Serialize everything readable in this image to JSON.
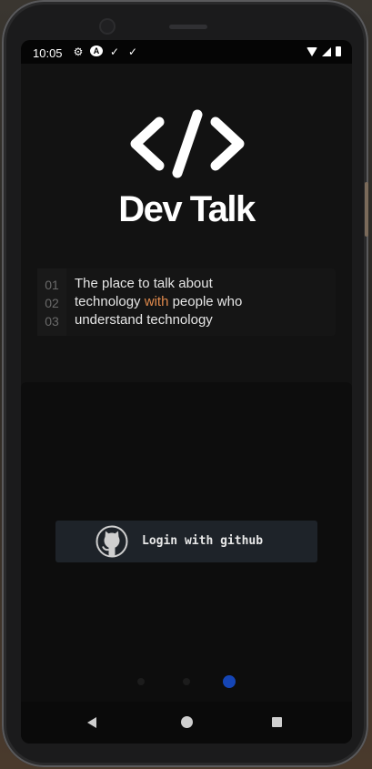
{
  "status_bar": {
    "time": "10:05",
    "left_icons": [
      "gear-icon",
      "a-badge-icon",
      "checkmark-icon",
      "checkmark-icon"
    ],
    "right_icons": [
      "wifi-icon",
      "signal-icon",
      "battery-icon"
    ]
  },
  "app": {
    "logo_icon": "code-brackets-icon",
    "title": "Dev Talk",
    "tagline": {
      "line_numbers": [
        "01",
        "02",
        "03"
      ],
      "line1": "The place to talk about",
      "line2_pre": "technology ",
      "line2_accent": "with",
      "line2_post": " people who",
      "line3": "understand technology"
    },
    "login_button": {
      "icon": "github-icon",
      "label": "Login with github"
    },
    "pager": {
      "count": 3,
      "active_index": 2
    }
  },
  "nav_bar": {
    "buttons": [
      "back",
      "home",
      "recents"
    ]
  },
  "colors": {
    "background": "#121212",
    "accent_text": "#e08a4c",
    "active_dot": "#1545b5",
    "button_bg": "#1e2329"
  }
}
